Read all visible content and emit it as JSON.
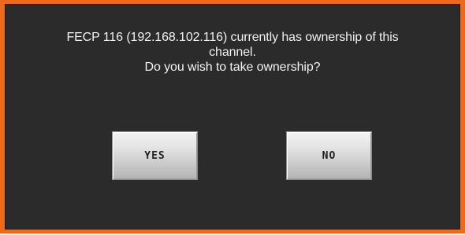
{
  "dialog": {
    "message_lines": [
      "FECP 116 (192.168.102.116) currently has ownership of this",
      "channel.",
      "Do you wish to take ownership?"
    ],
    "yes_label": "YES",
    "no_label": "NO"
  },
  "colors": {
    "frame": "#ec6a1b",
    "background": "#2b2b2b",
    "text": "#f2f2f2",
    "button_top": "#f3f3f3",
    "button_bottom": "#b3b3b3"
  }
}
